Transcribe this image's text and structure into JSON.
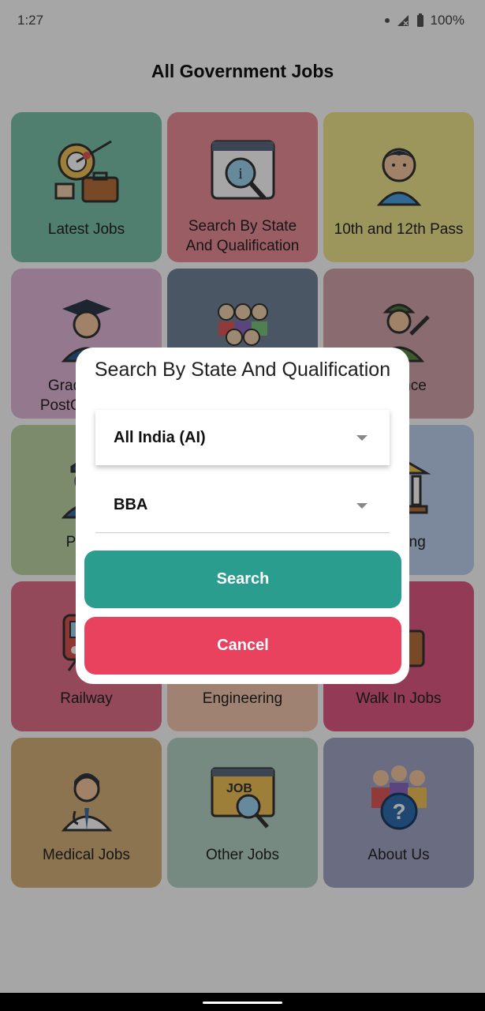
{
  "status": {
    "time": "1:27",
    "battery": "100%"
  },
  "appbar": {
    "title": "All Government Jobs"
  },
  "tiles": [
    {
      "label": "Latest Jobs",
      "color": "#7cc3ac",
      "icon": "job-growth-icon"
    },
    {
      "label": "Search By State And Qualification",
      "color": "#ec8f98",
      "icon": "magnifier-document-icon"
    },
    {
      "label": "10th and 12th Pass",
      "color": "#f2e78e",
      "icon": "student-icon"
    },
    {
      "label": "Graduate & PostGraduate",
      "color": "#e4b8da",
      "icon": "graduate-icon"
    },
    {
      "label": "",
      "color": "#73859a",
      "icon": "group-people-icon"
    },
    {
      "label": "Defence",
      "color": "#d4a7ad",
      "icon": "soldier-icon"
    },
    {
      "label": "Police",
      "color": "#bfd6a7",
      "icon": "police-icon"
    },
    {
      "label": "",
      "color": "#ffffff",
      "icon": ""
    },
    {
      "label": "Banking",
      "color": "#bfd3f0",
      "icon": "bank-icon"
    },
    {
      "label": "Railway",
      "color": "#e3718b",
      "icon": "train-icon"
    },
    {
      "label": "Engineering",
      "color": "#f6c8b0",
      "icon": "engineering-icon"
    },
    {
      "label": "Walk In Jobs",
      "color": "#e25a86",
      "icon": "briefcase-icon"
    },
    {
      "label": "Medical Jobs",
      "color": "#d9b27c",
      "icon": "doctor-icon"
    },
    {
      "label": "Other Jobs",
      "color": "#b5d5c6",
      "icon": "job-search-icon"
    },
    {
      "label": "About Us",
      "color": "#a3a8c6",
      "icon": "question-people-icon"
    }
  ],
  "dialog": {
    "title": "Search By State And Qualification",
    "state_value": "All India (AI)",
    "qualification_value": "BBA",
    "search_label": "Search",
    "cancel_label": "Cancel"
  }
}
